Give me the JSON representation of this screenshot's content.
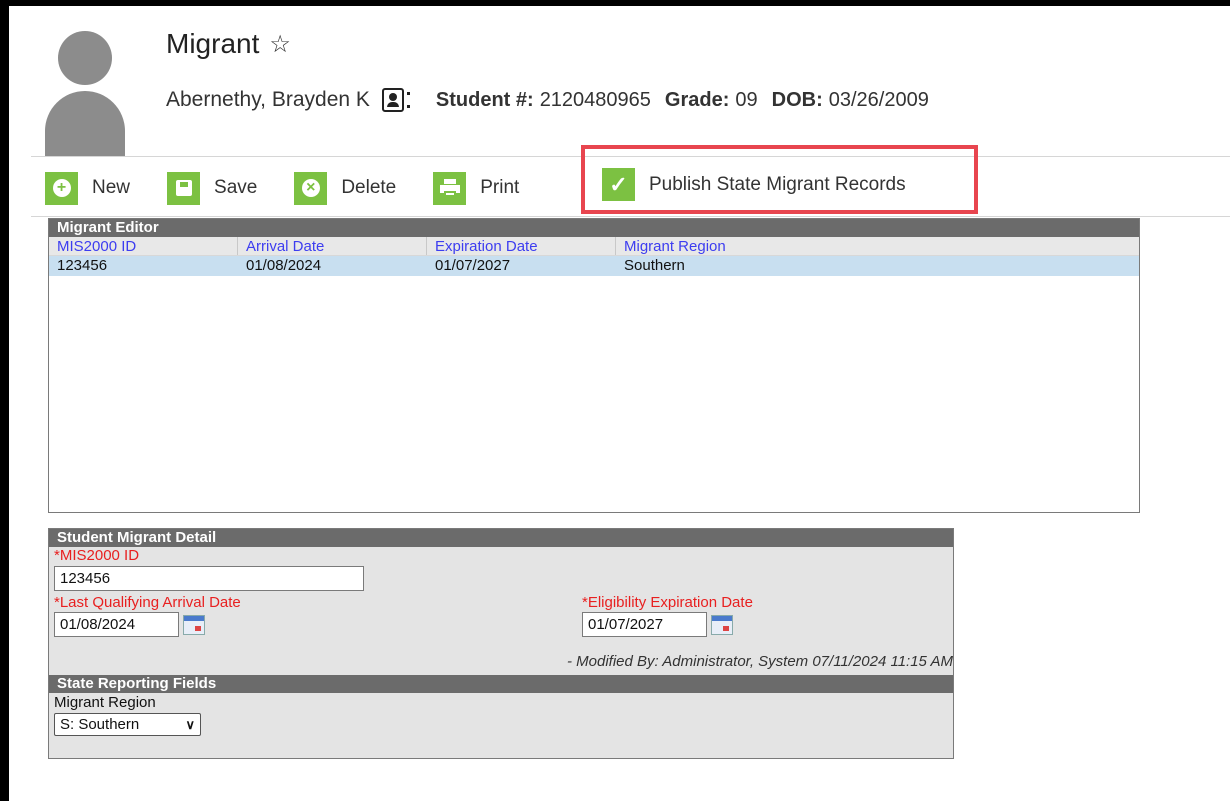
{
  "header": {
    "title": "Migrant",
    "student_name": "Abernethy, Brayden K",
    "student_number_label": "Student #:",
    "student_number": "2120480965",
    "grade_label": "Grade:",
    "grade": "09",
    "dob_label": "DOB:",
    "dob": "03/26/2009"
  },
  "toolbar": {
    "new_label": "New",
    "save_label": "Save",
    "delete_label": "Delete",
    "print_label": "Print",
    "publish_label": "Publish State Migrant Records",
    "accent_color": "#7cc142",
    "highlight_color": "#e8454f"
  },
  "editor": {
    "title": "Migrant Editor",
    "columns": [
      "MIS2000 ID",
      "Arrival Date",
      "Expiration Date",
      "Migrant Region"
    ],
    "rows": [
      [
        "123456",
        "01/08/2024",
        "01/07/2027",
        "Southern"
      ]
    ]
  },
  "detail": {
    "title": "Student Migrant Detail",
    "mis_label": "*MIS2000 ID",
    "mis_value": "123456",
    "arrival_label": "*Last Qualifying Arrival Date",
    "arrival_value": "01/08/2024",
    "expiration_label": "*Eligibility Expiration Date",
    "expiration_value": "01/07/2027",
    "modified_text": "- Modified By: Administrator, System 07/11/2024 11:15 AM",
    "state_title": "State Reporting Fields",
    "region_label": "Migrant Region",
    "region_value": "S: Southern"
  }
}
